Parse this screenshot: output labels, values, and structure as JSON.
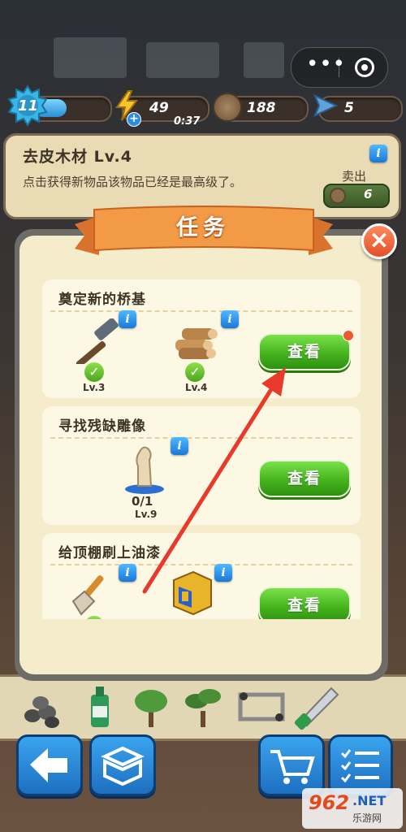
{
  "status": {
    "level": "11",
    "energy": "49",
    "energy_timer": "0:37",
    "coins": "188",
    "gems": "5"
  },
  "item": {
    "title": "去皮木材  Lv.4",
    "description": "点击获得新物品该物品已经是最高级了。",
    "sell_label": "卖出",
    "sell_price": "6",
    "info_icon": "i"
  },
  "modal": {
    "title": "任务",
    "close": "×",
    "tasks": [
      {
        "title": "奠定新的桥基",
        "button": "查看",
        "has_notification": true,
        "requirements": [
          {
            "icon": "hammer-icon",
            "level": "Lv.3",
            "done": true
          },
          {
            "icon": "wood-logs-icon",
            "level": "Lv.4",
            "done": true
          }
        ]
      },
      {
        "title": "寻找残缺雕像",
        "button": "查看",
        "requirements": [
          {
            "icon": "statue-icon",
            "progress": "0/1",
            "level": "Lv.9",
            "done": false
          }
        ]
      },
      {
        "title": "给顶棚刷上油漆",
        "button": "查看",
        "requirements": [
          {
            "icon": "paintbrush-icon",
            "done": true
          },
          {
            "icon": "mystery-box-icon",
            "done": false
          }
        ]
      }
    ]
  },
  "watermark": {
    "number": "962",
    "suffix": ".NET",
    "name": "乐游网"
  },
  "colors": {
    "accent_orange": "#f08a3c",
    "button_green": "#46b41d",
    "nav_blue": "#1e6fc0",
    "panel_cream": "#f4eccb"
  }
}
